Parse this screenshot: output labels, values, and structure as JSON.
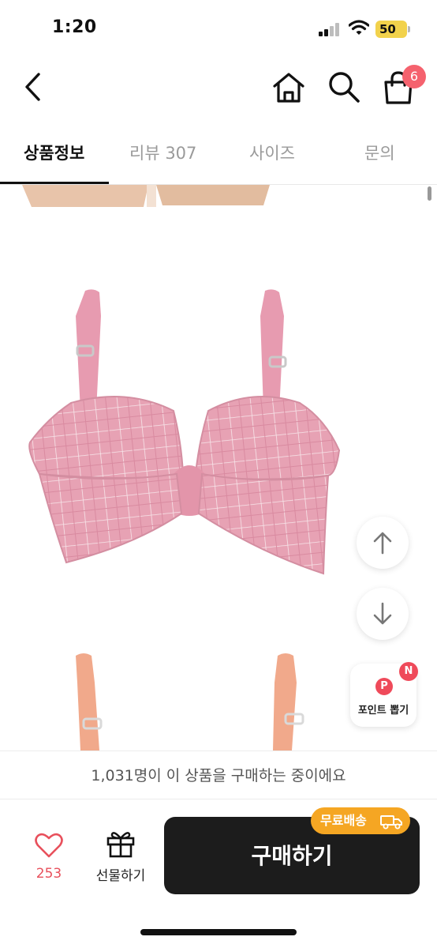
{
  "status_bar": {
    "time": "1:20",
    "battery": "50"
  },
  "header": {
    "cart_count": "6"
  },
  "tabs": [
    {
      "label": "상품정보"
    },
    {
      "label": "리뷰 307"
    },
    {
      "label": "사이즈"
    },
    {
      "label": "문의"
    }
  ],
  "floating": {
    "point_badge": "P",
    "new_badge": "N",
    "point_label": "포인트 뽑기"
  },
  "notice": "1,031명이 이 상품을 구매하는 중이에요",
  "bottom_bar": {
    "like_count": "253",
    "gift_label": "선물하기",
    "buy_label": "구매하기",
    "free_shipping": "무료배송"
  },
  "colors": {
    "accent_red": "#f5626e",
    "shipping_badge": "#f5a623",
    "buy_button": "#1c1c1c",
    "product_pink": "#e9a3b5",
    "product_peach": "#f2a98a"
  }
}
